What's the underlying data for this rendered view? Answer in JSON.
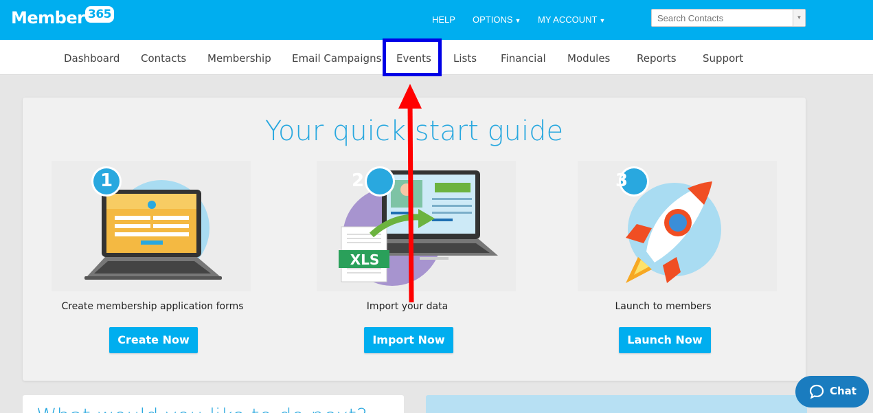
{
  "header": {
    "logo_text": "Member",
    "logo_number": "365",
    "help": "HELP",
    "options": "OPTIONS",
    "my_account": "MY ACCOUNT",
    "search_placeholder": "Search Contacts"
  },
  "nav": {
    "items": [
      "Dashboard",
      "Contacts",
      "Membership",
      "Email Campaigns",
      "Events",
      "Lists",
      "Financial",
      "Modules",
      "Reports",
      "Support"
    ]
  },
  "quick_start": {
    "title": "Your quick start guide",
    "steps": [
      {
        "number": "1",
        "label": "Create membership application forms",
        "button": "Create Now"
      },
      {
        "number": "2",
        "label": "Import your data",
        "button": "Import Now",
        "badge": "XLS"
      },
      {
        "number": "3",
        "label": "Launch to members",
        "button": "Launch Now"
      }
    ]
  },
  "lower": {
    "left_heading": "What would you like to do next?"
  },
  "chat": {
    "label": "Chat"
  },
  "colors": {
    "brand": "#00aeef",
    "title": "#29a8df",
    "highlight": "#0000e6",
    "arrow": "#ff0000"
  }
}
